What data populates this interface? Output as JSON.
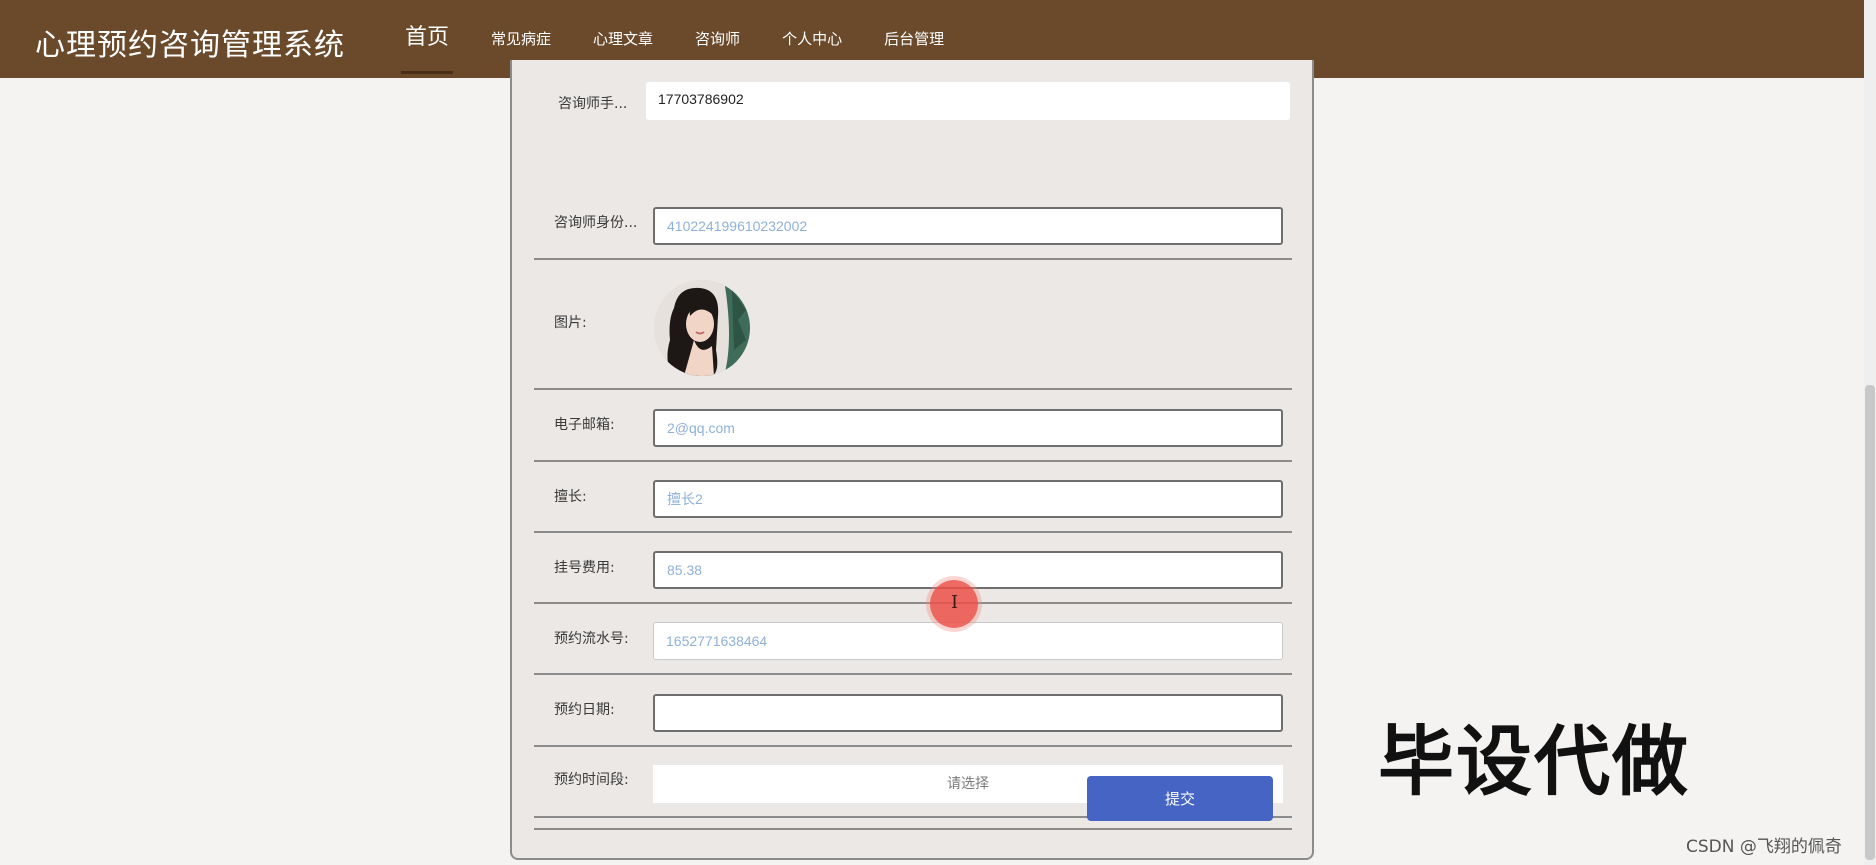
{
  "header": {
    "title": "心理预约咨询管理系统",
    "nav": [
      {
        "label": "首页",
        "active": true
      },
      {
        "label": "常见病症",
        "active": false
      },
      {
        "label": "心理文章",
        "active": false
      },
      {
        "label": "咨询师",
        "active": false
      },
      {
        "label": "个人中心",
        "active": false
      },
      {
        "label": "后台管理",
        "active": false
      }
    ]
  },
  "form": {
    "phone": {
      "label": "咨询师手...",
      "value": "17703786902"
    },
    "id_card": {
      "label": "咨询师身份...",
      "value": "410224199610232002"
    },
    "image": {
      "label": "图片:"
    },
    "email": {
      "label": "电子邮箱:",
      "value": "2@qq.com"
    },
    "specialty": {
      "label": "擅长:",
      "value": "擅长2"
    },
    "fee": {
      "label": "挂号费用:",
      "value": "85.38"
    },
    "serial": {
      "label": "预约流水号:",
      "value": "1652771638464"
    },
    "date": {
      "label": "预约日期:",
      "value": ""
    },
    "time_slot": {
      "label": "预约时间段:",
      "placeholder": "请选择"
    },
    "submit_label": "提交"
  },
  "overlay": {
    "promo_text": "毕设代做",
    "watermark": "CSDN @飞翔的佩奇"
  },
  "colors": {
    "header_bg": "#6b4a2b",
    "submit_bg": "#4564c3",
    "input_value": "#8fb1d9"
  }
}
